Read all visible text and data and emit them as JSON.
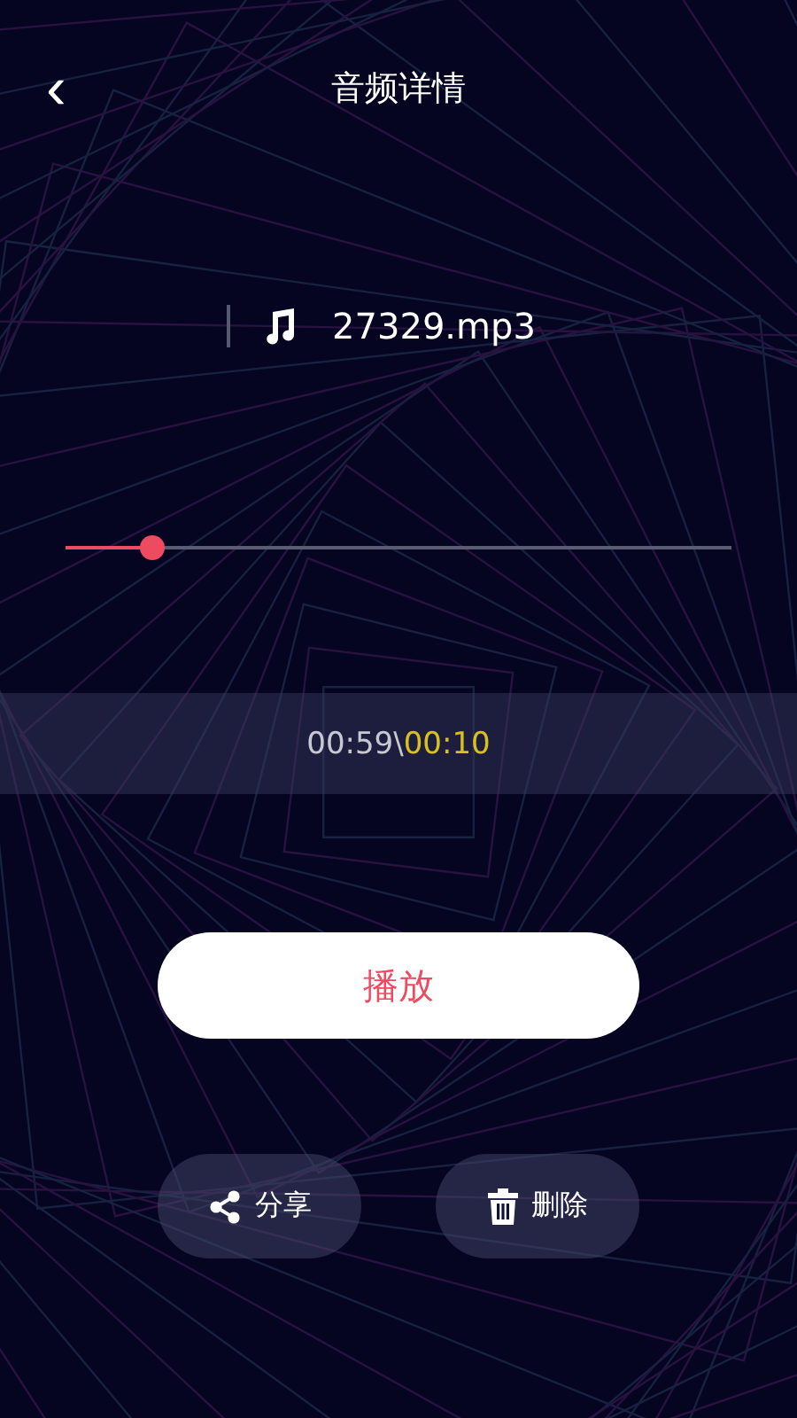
{
  "header": {
    "back_glyph": "‹",
    "title": "音频详情"
  },
  "file": {
    "name": "27329.mp3"
  },
  "progress": {
    "level": 0.13
  },
  "time": {
    "duration": "00:59",
    "separator": "\\",
    "current": "00:10"
  },
  "play_button": {
    "label": "播放"
  },
  "actions": [
    {
      "kind": "share",
      "label": "分享"
    },
    {
      "kind": "delete",
      "label": "删除"
    }
  ]
}
